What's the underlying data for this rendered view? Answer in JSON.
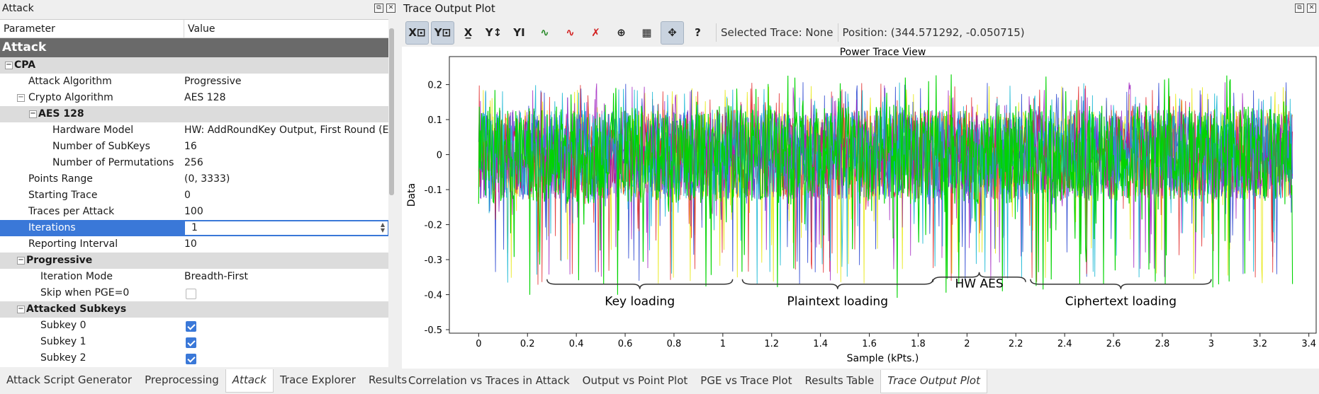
{
  "left_dock": {
    "title": "Attack",
    "float_icon": "⧉",
    "close_icon": "✕",
    "columns": {
      "param": "Parameter",
      "value": "Value"
    },
    "rows": [
      {
        "type": "top",
        "label": "Attack"
      },
      {
        "type": "group",
        "label": "CPA",
        "indent": 0,
        "expander": "−"
      },
      {
        "type": "param",
        "label": "Attack Algorithm",
        "value": "Progressive",
        "indent": 1
      },
      {
        "type": "param",
        "label": "Crypto Algorithm",
        "value": "AES 128",
        "indent": 1,
        "expander": "−"
      },
      {
        "type": "group",
        "label": "AES 128",
        "indent": 2,
        "expander": "−"
      },
      {
        "type": "param",
        "label": "Hardware Model",
        "value": "HW: AddRoundKey Output, First Round (En",
        "indent": 3
      },
      {
        "type": "param",
        "label": "Number of SubKeys",
        "value": "16",
        "indent": 3
      },
      {
        "type": "param",
        "label": "Number of Permutations",
        "value": "256",
        "indent": 3
      },
      {
        "type": "param",
        "label": "Points Range",
        "value": "(0, 3333)",
        "indent": 1
      },
      {
        "type": "param",
        "label": "Starting Trace",
        "value": "0",
        "indent": 1
      },
      {
        "type": "param",
        "label": "Traces per Attack",
        "value": "100",
        "indent": 1
      },
      {
        "type": "spin",
        "label": "Iterations",
        "value": "1",
        "indent": 1
      },
      {
        "type": "param",
        "label": "Reporting Interval",
        "value": "10",
        "indent": 1
      },
      {
        "type": "group",
        "label": "Progressive",
        "indent": 1,
        "expander": "−"
      },
      {
        "type": "param",
        "label": "Iteration Mode",
        "value": "Breadth-First",
        "indent": 2
      },
      {
        "type": "check",
        "label": "Skip when PGE=0",
        "checked": false,
        "indent": 2
      },
      {
        "type": "group",
        "label": "Attacked Subkeys",
        "indent": 1,
        "expander": "−"
      },
      {
        "type": "check",
        "label": "Subkey 0",
        "checked": true,
        "indent": 2
      },
      {
        "type": "check",
        "label": "Subkey 1",
        "checked": true,
        "indent": 2
      },
      {
        "type": "check",
        "label": "Subkey 2",
        "checked": true,
        "indent": 2
      }
    ],
    "tabs": [
      {
        "label": "Attack Script Generator",
        "active": false
      },
      {
        "label": "Preprocessing",
        "active": false
      },
      {
        "label": "Attack",
        "active": true
      },
      {
        "label": "Trace Explorer",
        "active": false
      },
      {
        "label": "Results",
        "active": false
      }
    ]
  },
  "right_dock": {
    "title": "Trace Output Plot",
    "toolbar": {
      "buttons": [
        {
          "name": "x-lock-button",
          "glyph": "X⊡",
          "on": true
        },
        {
          "name": "y-lock-button",
          "glyph": "Y⊡",
          "on": true
        },
        {
          "name": "x-autoscale-button",
          "glyph": "X̲",
          "on": false
        },
        {
          "name": "y-autoscale-button",
          "glyph": "Y↕",
          "on": false
        },
        {
          "name": "y-default-button",
          "glyph": "YI",
          "on": false
        },
        {
          "name": "legend-toggle-button",
          "glyph": "∿",
          "color": "#2a8a2a",
          "on": false
        },
        {
          "name": "show-traces-button",
          "glyph": "∿",
          "color": "#d21f1f",
          "on": false
        },
        {
          "name": "hide-traces-button",
          "glyph": "✗",
          "color": "#d21f1f",
          "on": false
        },
        {
          "name": "crosshair-button",
          "glyph": "⊕",
          "on": false
        },
        {
          "name": "grid-button",
          "glyph": "▦",
          "on": false
        },
        {
          "name": "pan-button",
          "glyph": "✥",
          "on": true
        },
        {
          "name": "help-button",
          "glyph": "?",
          "on": false
        }
      ],
      "selected_trace": "Selected Trace: None",
      "position": "Position: (344.571292, -0.050715)"
    },
    "tabs": [
      {
        "label": "Correlation vs Traces in Attack",
        "active": false
      },
      {
        "label": "Output vs Point Plot",
        "active": false
      },
      {
        "label": "PGE vs Trace Plot",
        "active": false
      },
      {
        "label": "Results Table",
        "active": false
      },
      {
        "label": "Trace Output Plot",
        "active": true
      }
    ]
  },
  "chart_data": {
    "type": "line",
    "title": "Power Trace View",
    "xlabel": "Sample (kPts.)",
    "ylabel": "Data",
    "xlim": [
      -0.12,
      3.43
    ],
    "ylim": [
      -0.51,
      0.28
    ],
    "xticks": [
      "0",
      "0.2",
      "0.4",
      "0.6",
      "0.8",
      "1",
      "1.2",
      "1.4",
      "1.6",
      "1.8",
      "2",
      "2.2",
      "2.4",
      "2.6",
      "2.8",
      "3",
      "3.2",
      "3.4"
    ],
    "yticks": [
      "0.2",
      "0.1",
      "0",
      "-0.1",
      "-0.2",
      "-0.3",
      "-0.4",
      "-0.5"
    ],
    "series_colors": [
      "#00d400",
      "#e6e600",
      "#1f3ccf",
      "#e02020",
      "#a020c0",
      "#00b0d0"
    ],
    "x_range_kpts": [
      0,
      3.333
    ],
    "amplitude": {
      "typical_min": -0.15,
      "typical_max": 0.15,
      "peak_max": 0.25,
      "peak_min": -0.46
    },
    "annotations": [
      {
        "text": "Key loading",
        "x_from": 0.28,
        "x_to": 1.04
      },
      {
        "text": "Plaintext loading",
        "x_from": 1.08,
        "x_to": 1.86
      },
      {
        "text": "HW AES",
        "x_from": 1.86,
        "x_to": 2.24
      },
      {
        "text": "Ciphertext loading",
        "x_from": 2.26,
        "x_to": 3.0
      }
    ]
  }
}
